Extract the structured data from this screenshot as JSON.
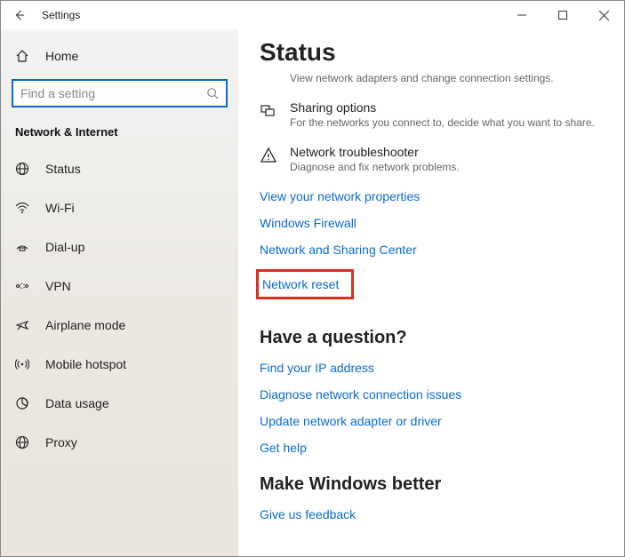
{
  "window": {
    "title": "Settings"
  },
  "sidebar": {
    "home": "Home",
    "search_placeholder": "Find a setting",
    "section": "Network & Internet",
    "items": [
      {
        "label": "Status"
      },
      {
        "label": "Wi-Fi"
      },
      {
        "label": "Dial-up"
      },
      {
        "label": "VPN"
      },
      {
        "label": "Airplane mode"
      },
      {
        "label": "Mobile hotspot"
      },
      {
        "label": "Data usage"
      },
      {
        "label": "Proxy"
      }
    ]
  },
  "main": {
    "title": "Status",
    "truncated_line": "View network adapters and change connection settings.",
    "sharing": {
      "title": "Sharing options",
      "sub": "For the networks you connect to, decide what you want to share."
    },
    "trouble": {
      "title": "Network troubleshooter",
      "sub": "Diagnose and fix network problems."
    },
    "links": [
      "View your network properties",
      "Windows Firewall",
      "Network and Sharing Center",
      "Network reset"
    ],
    "question": {
      "heading": "Have a question?",
      "links": [
        "Find your IP address",
        "Diagnose network connection issues",
        "Update network adapter or driver",
        "Get help"
      ]
    },
    "better": {
      "heading": "Make Windows better",
      "link": "Give us feedback"
    }
  }
}
